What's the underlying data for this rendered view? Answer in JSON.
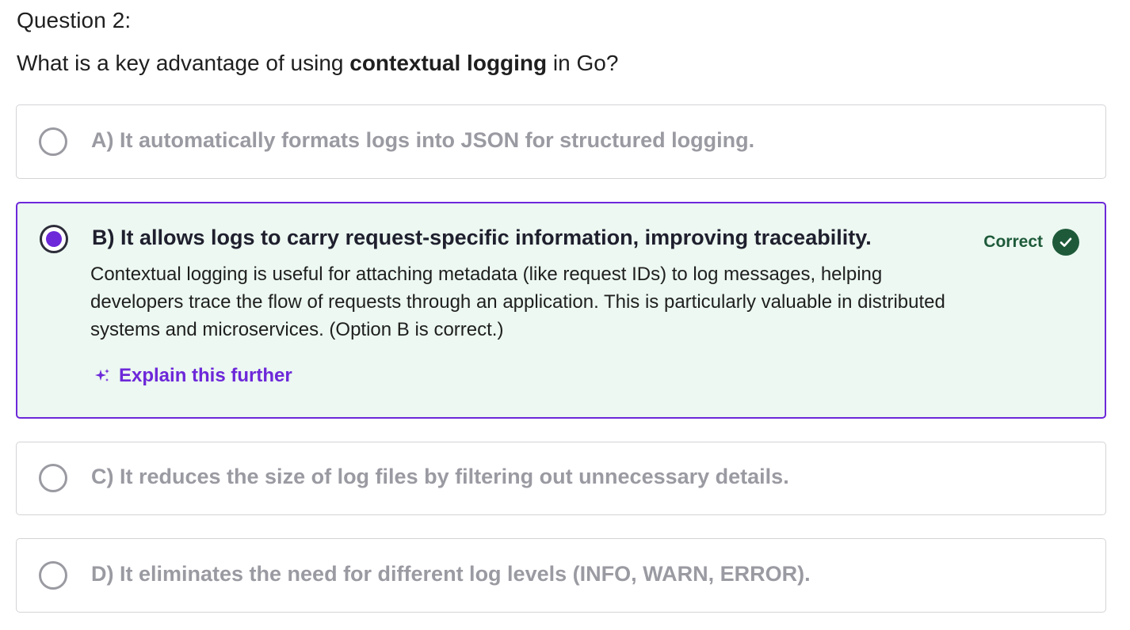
{
  "question": {
    "number_label": "Question 2:",
    "text_before": "What is a key advantage of using ",
    "text_bold": "contextual logging",
    "text_after": " in Go?"
  },
  "options": [
    {
      "label": "A) It automatically formats logs into JSON for structured logging.",
      "selected": false
    },
    {
      "label": "B) It allows logs to carry request-specific information, improving traceability.",
      "selected": true,
      "status": "Correct",
      "feedback": "Contextual logging is useful for attaching metadata (like request IDs) to log messages, helping developers trace the flow of requests through an application. This is particularly valuable in distributed systems and microservices. (Option B is correct.)",
      "explain_label": "Explain this further"
    },
    {
      "label": "C) It reduces the size of log files by filtering out unnecessary details.",
      "selected": false
    },
    {
      "label": "D) It eliminates the need for different log levels (INFO, WARN, ERROR).",
      "selected": false
    }
  ],
  "colors": {
    "accent": "#6d28d9",
    "correct": "#1e5a3a",
    "selected_bg": "#ecf8f1",
    "muted_text": "#9a9aa2"
  },
  "icons": {
    "explain": "sparkle-icon",
    "correct": "check-circle-icon"
  }
}
